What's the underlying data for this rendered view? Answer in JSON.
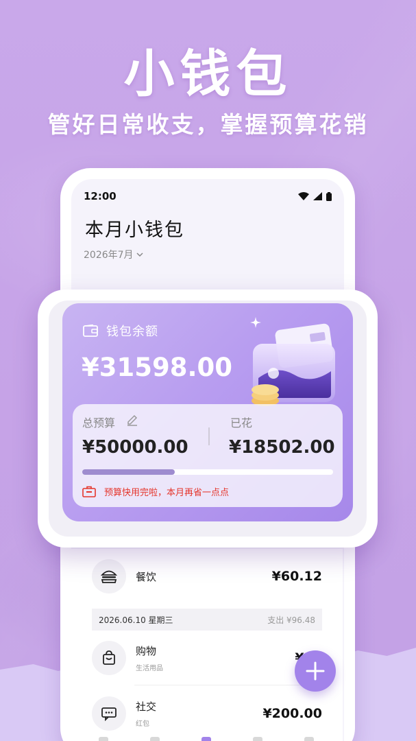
{
  "banner": {
    "headline": "小钱包",
    "subline": "管好日常收支，掌握预算花销"
  },
  "status_bar": {
    "time": "12:00"
  },
  "app": {
    "title": "本月小钱包",
    "month_picker": "2026年7月"
  },
  "balance_card": {
    "label": "钱包余额",
    "amount": "¥31598.00",
    "budget_label": "总预算",
    "budget_amount": "¥50000.00",
    "spent_label": "已花",
    "spent_amount": "¥18502.00",
    "budget_used_fraction": 0.37,
    "warning": "预算快用完啦，本月再省一点点"
  },
  "transactions": {
    "first_item": {
      "name": "餐饮",
      "amount": "¥60.12",
      "icon": "burger-icon"
    },
    "day_group": {
      "date": "2026.06.10 星期三",
      "total": "支出 ¥96.48",
      "items": [
        {
          "name": "购物",
          "note": "生活用品",
          "amount": "¥36",
          "icon": "shopping-bag-icon"
        },
        {
          "name": "社交",
          "note": "红包",
          "amount": "¥200.00",
          "icon": "chat-icon"
        }
      ]
    }
  },
  "fab": {
    "icon": "plus-icon"
  },
  "colors": {
    "background": "#c9a8ea",
    "accent": "#a283ea",
    "warning": "#e5352b"
  }
}
